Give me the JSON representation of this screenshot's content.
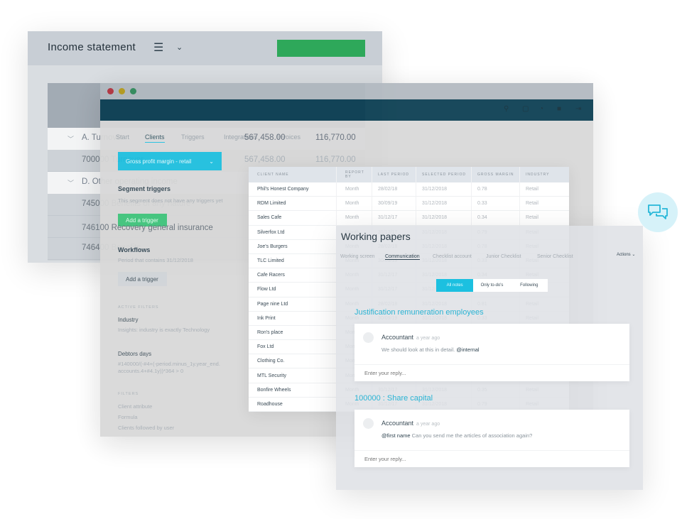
{
  "income": {
    "title": "Income statement",
    "menu_icon": "hamburger-icon",
    "rows": [
      {
        "label": "A. Turnover",
        "v1": "567,458.00",
        "v2": "116,770.00"
      },
      {
        "label": "700000 Turnover",
        "v1": "567,458.00",
        "v2": "116,770.00"
      },
      {
        "label": "D. Other operating income"
      },
      {
        "label": "745000 Benefits of any nature"
      },
      {
        "label": "746100 Recovery general insurance"
      },
      {
        "label": "746400 Benefits"
      }
    ]
  },
  "clients": {
    "tabs": [
      "Start",
      "Clients",
      "Triggers",
      "Integrations",
      "Invoices"
    ],
    "active_tab": "Clients",
    "dropdown": "Gross profit margin - retail",
    "segment_title": "Segment triggers",
    "segment_empty": "This segment does not have any triggers yet",
    "add_trigger": "Add a trigger",
    "workflows_title": "Workflows",
    "workflows_sub": "Period that contains 31/12/2018",
    "active_filters": "ACTIVE FILTERS",
    "filter1_label": "Industry",
    "filter1_value": "Insights: industry is exactly Technology",
    "filter2_label": "Debtors days",
    "filter2_value_1": "#140000/(-#4+(-period.minus_1y.year_end.",
    "filter2_value_2": "accounts.4+#4.1y))*364 > 0",
    "filters": "FILTERS",
    "filter_options": [
      "Client attribute",
      "Formula",
      "Clients followed by user"
    ],
    "table": {
      "headers": [
        "CLIENT NAME",
        "REPORT BY",
        "LAST PERIOD",
        "SELECTED PERIOD",
        "GROSS MARGIN",
        "INDUSTRY"
      ],
      "rows": [
        [
          "Phil's Honest Company",
          "Month",
          "28/02/18",
          "31/12/2018",
          "0.78",
          "Retail"
        ],
        [
          "RDM Limited",
          "Month",
          "30/09/19",
          "31/12/2018",
          "0.33",
          "Retail"
        ],
        [
          "Sales Cafe",
          "Month",
          "31/12/17",
          "31/12/2018",
          "0.34",
          "Retail"
        ],
        [
          "Silverfox Ltd",
          "Month",
          "31/12/17",
          "31/12/2018",
          "0.79",
          "Retail"
        ],
        [
          "Joe's Burgers",
          "Month",
          "28/02/18",
          "31/12/2018",
          "0.78",
          "Retail"
        ],
        [
          "TLC Limited",
          "Month",
          "30/09/19",
          "31/12/2018",
          "0.33",
          "Retail"
        ],
        [
          "Cafe Racers",
          "Month",
          "31/12/17",
          "31/12/2018",
          "0.34",
          "Retail"
        ],
        [
          "Flow Ltd",
          "Month",
          "31/12/17",
          "31/12/2018",
          "",
          "Retail"
        ],
        [
          "Page nine Ltd",
          "Month",
          "28/02/18",
          "31/12/2018",
          "0.81",
          "Retail"
        ],
        [
          "Ink Print",
          "Month",
          "30/09/19",
          "31/12/2018",
          "0.33",
          "Retail"
        ],
        [
          "Ron's place",
          "Month",
          "",
          "",
          "",
          ""
        ],
        [
          "Fox Ltd",
          "Month",
          "",
          "",
          "",
          ""
        ],
        [
          "Clothing Co.",
          "Month",
          "",
          "",
          "",
          ""
        ],
        [
          "MTL Security",
          "Month",
          "",
          "",
          "",
          ""
        ],
        [
          "Bonfire Wheels",
          "Month",
          "31/12/17",
          "31/12/2018",
          "0.35",
          "Retail"
        ],
        [
          "Roadhouse",
          "Month",
          "31/12/17",
          "31/12/2018",
          "0.79",
          "Retail"
        ]
      ]
    }
  },
  "working": {
    "title": "Working papers",
    "tabs": [
      "Working screen",
      "Communication",
      "Checklist account",
      "Junior Checklist",
      "Senior Checklist"
    ],
    "active_tab": "Communication",
    "actions": "Actions",
    "segments": [
      "All notes",
      "Only to-do's",
      "Following"
    ],
    "notes": [
      {
        "section": "Justification remuneration employees",
        "author": "Accountant",
        "time": "a year ago",
        "mention": "@internal",
        "text": "We should look at this in detail.",
        "mention_first": false,
        "reply_placeholder": "Enter your reply..."
      },
      {
        "section": "100000 : Share capital",
        "author": "Accountant",
        "time": "a year ago",
        "mention": "@first name",
        "text": "Can you send me the articles of association again?",
        "mention_first": true,
        "reply_placeholder": "Enter your reply..."
      }
    ]
  },
  "colors": {
    "accent": "#1cc0e0",
    "green": "#2ea85a",
    "nav": "#083c50"
  },
  "chat_icon": "chat-bubbles-icon"
}
